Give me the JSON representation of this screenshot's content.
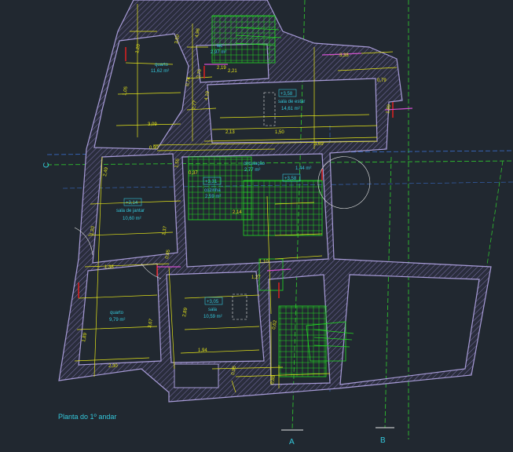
{
  "drawing": {
    "title": "Planta do 1º andar",
    "background": "#212830",
    "colors": {
      "wall": "#a89cd8",
      "dim": "#e6e619",
      "room_text": "#34c8dc",
      "grid": "#2fbf2f",
      "grid_blue": "#3a6fd0",
      "fixtures": "#22dd22",
      "magenta": "#d050d0",
      "red": "#e02020",
      "white": "#e8e8e8"
    },
    "grid_labels": {
      "a": "A",
      "b": "B",
      "c": "C"
    }
  },
  "rooms": {
    "quarto_top": {
      "name": "quarto",
      "area": "11,62 m²"
    },
    "wc": {
      "name": "wc",
      "area": "2,97 m²"
    },
    "sala_estar": {
      "name": "sala de estar",
      "area": "14,61 m²",
      "level": "+3,58"
    },
    "circulacao": {
      "name": "circulação",
      "area": "2,77 m²"
    },
    "area_small": {
      "area": "1,44 m²",
      "level": "+3,58"
    },
    "cozinha": {
      "name": "cozinha",
      "area": "2,59 m²",
      "level": "+3,31"
    },
    "sala_jantar": {
      "name": "sala de jantar",
      "area": "10,60 m²",
      "level": "+3,14"
    },
    "quarto_bottom": {
      "name": "quarto",
      "area": "9,79 m²"
    },
    "sala": {
      "name": "sala",
      "area": "10,59 m²",
      "level": "+3,05"
    }
  },
  "dimensions": {
    "d1": "3,09",
    "d2": "2,13",
    "d3": "0,90",
    "d4": "4,96",
    "d5": "0,75",
    "d6": "1,77",
    "d7": "4,19",
    "d8": "3,69",
    "d9": "1,50",
    "d10": "1,37",
    "d11": "2,49",
    "d12": "1,20",
    "d13": "1,38",
    "d14": "3,67",
    "d15": "2,89",
    "d16": "1,89",
    "d17": "2,30",
    "d18": "1,94",
    "d19": "0,95",
    "d20": "0,85",
    "d21": "2,14",
    "d22": "0,62",
    "d23": "1,27",
    "d24": "3,38",
    "d25": "0,79",
    "d26": "1,89",
    "d27": "0,88",
    "d28": "1,05",
    "d29": "2,19",
    "d30": "3,50",
    "d31": "1,10",
    "d32": "0,74",
    "d33": "0,37",
    "d34": "2,21",
    "d35": "1,55"
  }
}
